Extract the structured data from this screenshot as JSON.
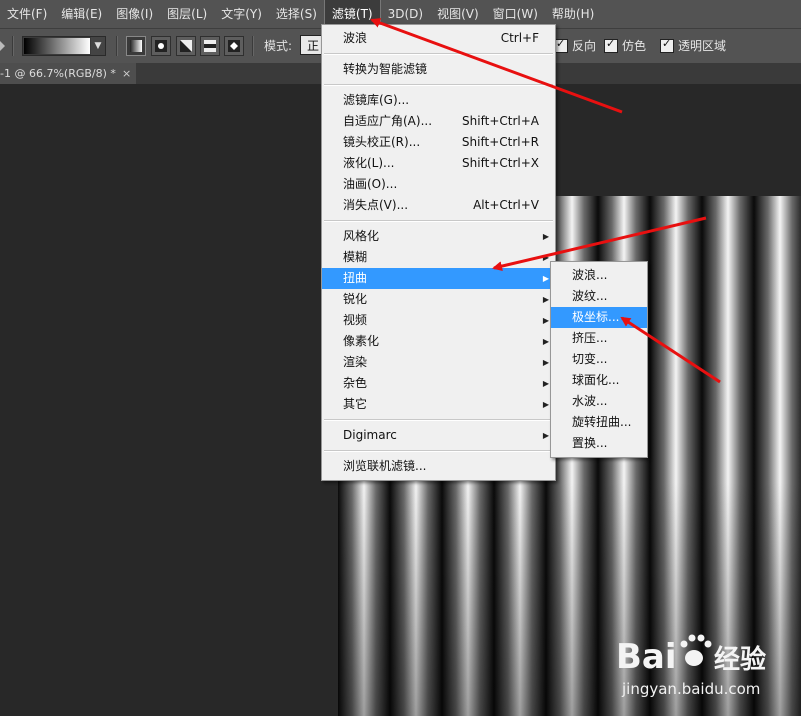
{
  "menubar": {
    "items": [
      "文件(F)",
      "编辑(E)",
      "图像(I)",
      "图层(L)",
      "文字(Y)",
      "选择(S)",
      "滤镜(T)",
      "3D(D)",
      "视图(V)",
      "窗口(W)",
      "帮助(H)"
    ],
    "active_index": 6
  },
  "options_bar": {
    "mode_label": "模式:",
    "mode_value": "正",
    "checkboxes": [
      {
        "label": "反向",
        "checked": true
      },
      {
        "label": "仿色",
        "checked": true
      },
      {
        "label": "透明区域",
        "checked": true
      }
    ]
  },
  "document_tab": {
    "title": "-1 @ 66.7%(RGB/8) *",
    "close": "×"
  },
  "filter_menu": {
    "groups": [
      [
        {
          "label": "波浪",
          "shortcut": "Ctrl+F"
        }
      ],
      [
        {
          "label": "转换为智能滤镜"
        }
      ],
      [
        {
          "label": "滤镜库(G)..."
        },
        {
          "label": "自适应广角(A)...",
          "shortcut": "Shift+Ctrl+A"
        },
        {
          "label": "镜头校正(R)...",
          "shortcut": "Shift+Ctrl+R"
        },
        {
          "label": "液化(L)...",
          "shortcut": "Shift+Ctrl+X"
        },
        {
          "label": "油画(O)..."
        },
        {
          "label": "消失点(V)...",
          "shortcut": "Alt+Ctrl+V"
        }
      ],
      [
        {
          "label": "风格化",
          "submenu": true
        },
        {
          "label": "模糊",
          "submenu": true
        },
        {
          "label": "扭曲",
          "submenu": true,
          "highlighted": true
        },
        {
          "label": "锐化",
          "submenu": true
        },
        {
          "label": "视频",
          "submenu": true
        },
        {
          "label": "像素化",
          "submenu": true
        },
        {
          "label": "渲染",
          "submenu": true
        },
        {
          "label": "杂色",
          "submenu": true
        },
        {
          "label": "其它",
          "submenu": true
        }
      ],
      [
        {
          "label": "Digimarc",
          "submenu": true
        }
      ],
      [
        {
          "label": "浏览联机滤镜..."
        }
      ]
    ]
  },
  "distort_menu": {
    "items": [
      {
        "label": "波浪..."
      },
      {
        "label": "波纹..."
      },
      {
        "label": "极坐标...",
        "highlighted": true
      },
      {
        "label": "挤压..."
      },
      {
        "label": "切变..."
      },
      {
        "label": "球面化..."
      },
      {
        "label": "水波..."
      },
      {
        "label": "旋转扭曲..."
      },
      {
        "label": "置换..."
      }
    ]
  },
  "watermark": {
    "logo_text": "Bai du 经验",
    "url": "jingyan.baidu.com"
  },
  "colors": {
    "menu_highlight": "#3399ff",
    "annotation_arrow": "#e81010"
  }
}
